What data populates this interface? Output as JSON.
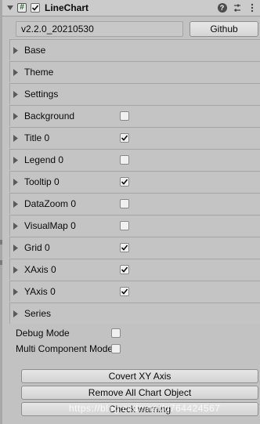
{
  "header": {
    "title": "LineChart",
    "script_icon_glyph": "#",
    "icons": [
      "help-icon",
      "preset-icon",
      "more-icon"
    ],
    "help_glyph": "?"
  },
  "version": {
    "text": "v2.2.0_20210530",
    "github_label": "Github"
  },
  "sections": [
    {
      "label": "Base",
      "checkbox": null
    },
    {
      "label": "Theme",
      "checkbox": null
    },
    {
      "label": "Settings",
      "checkbox": null
    },
    {
      "label": "Background",
      "checkbox": false
    },
    {
      "label": "Title 0",
      "checkbox": true
    },
    {
      "label": "Legend 0",
      "checkbox": false
    },
    {
      "label": "Tooltip 0",
      "checkbox": true
    },
    {
      "label": "DataZoom 0",
      "checkbox": false
    },
    {
      "label": "VisualMap 0",
      "checkbox": false
    },
    {
      "label": "Grid 0",
      "checkbox": true
    },
    {
      "label": "XAxis 0",
      "checkbox": true
    },
    {
      "label": "YAxis 0",
      "checkbox": true
    },
    {
      "label": "Series",
      "checkbox": null
    }
  ],
  "options": [
    {
      "label": "Debug Mode",
      "checked": false
    },
    {
      "label": "Multi Component Mode",
      "checked": false
    }
  ],
  "buttons": {
    "covert": "Covert XY Axis",
    "remove": "Remove All Chart Object",
    "check": "Check warning"
  },
  "watermark": "https://blog.csdn.net/q764424567",
  "colors": {
    "background": "#c2c2c2",
    "check_green": "#1a1a1a",
    "script_green": "#2a6e2a"
  }
}
